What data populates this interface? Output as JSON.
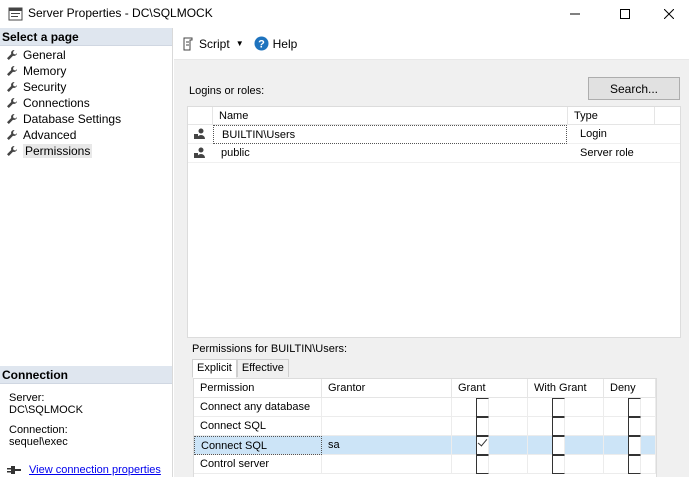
{
  "window": {
    "title": "Server Properties - DC\\SQLMOCK"
  },
  "left_pane": {
    "header": "Select a page",
    "pages": [
      {
        "label": "General"
      },
      {
        "label": "Memory"
      },
      {
        "label": "Security"
      },
      {
        "label": "Connections"
      },
      {
        "label": "Database Settings"
      },
      {
        "label": "Advanced"
      },
      {
        "label": "Permissions"
      }
    ],
    "connection": {
      "header": "Connection",
      "server_label": "Server:",
      "server_value": "DC\\SQLMOCK",
      "connection_label": "Connection:",
      "connection_value": "sequel\\exec",
      "view_link": "View connection properties"
    }
  },
  "toolbar": {
    "script_label": "Script",
    "help_label": "Help"
  },
  "logins": {
    "label": "Logins or roles:",
    "search_button": "Search...",
    "columns": [
      "Name",
      "Type"
    ],
    "rows": [
      {
        "name": "BUILTIN\\Users",
        "type": "Login"
      },
      {
        "name": "public",
        "type": "Server role"
      }
    ]
  },
  "permissions": {
    "label": "Permissions for BUILTIN\\Users:",
    "tabs": [
      "Explicit",
      "Effective"
    ],
    "columns": [
      "Permission",
      "Grantor",
      "Grant",
      "With Grant",
      "Deny"
    ],
    "rows": [
      {
        "permission": "Connect any database",
        "grantor": "",
        "grant": false,
        "with_grant": false,
        "deny": false
      },
      {
        "permission": "Connect SQL",
        "grantor": "",
        "grant": false,
        "with_grant": false,
        "deny": false
      },
      {
        "permission": "Connect SQL",
        "grantor": "sa",
        "grant": true,
        "with_grant": false,
        "deny": false
      },
      {
        "permission": "Control server",
        "grantor": "",
        "grant": false,
        "with_grant": false,
        "deny": false
      }
    ]
  }
}
